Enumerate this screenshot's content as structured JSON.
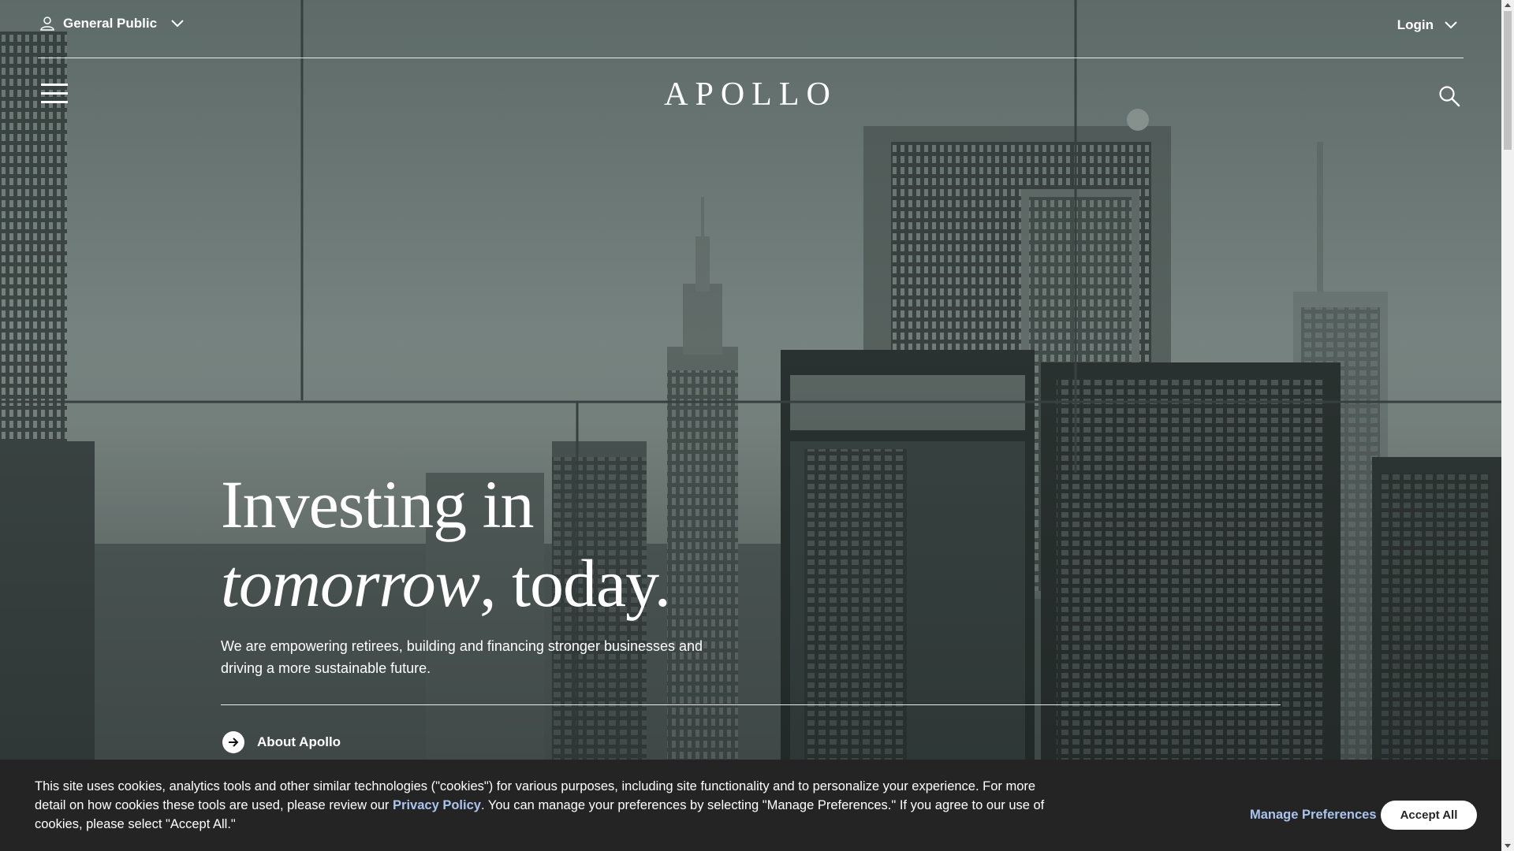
{
  "utility": {
    "audience_label": "General Public",
    "login_label": "Login"
  },
  "header": {
    "logo": "APOLLO"
  },
  "hero": {
    "title_line1": "Investing in",
    "title_italic": "tomorrow",
    "title_rest": ", today.",
    "subtitle": "We are empowering retirees, building and financing stronger businesses and driving a more sustainable future.",
    "cta_label": "About Apollo"
  },
  "cookie_banner": {
    "text_before_link": "This site uses cookies, analytics tools and other similar technologies (\"cookies\") for various purposes, including site functionality and to personalize your experience. For more detail on how cookies these tools are used, please review our ",
    "link_label": "Privacy Policy",
    "text_after_link": ". You can manage your preferences by selecting \"Manage Preferences.\" If you agree to our use of cookies, please select \"Accept All.\"",
    "manage_label": "Manage Preferences",
    "accept_label": "Accept All"
  },
  "colors": {
    "banner_bg": "#242424",
    "link": "#a9c4ee",
    "scene_base": "#4a5755"
  },
  "icons": {
    "user": "user-icon",
    "chevron": "chevron-down-icon",
    "menu": "hamburger-menu-icon",
    "search": "search-icon",
    "arrow": "arrow-right-circle-icon"
  }
}
